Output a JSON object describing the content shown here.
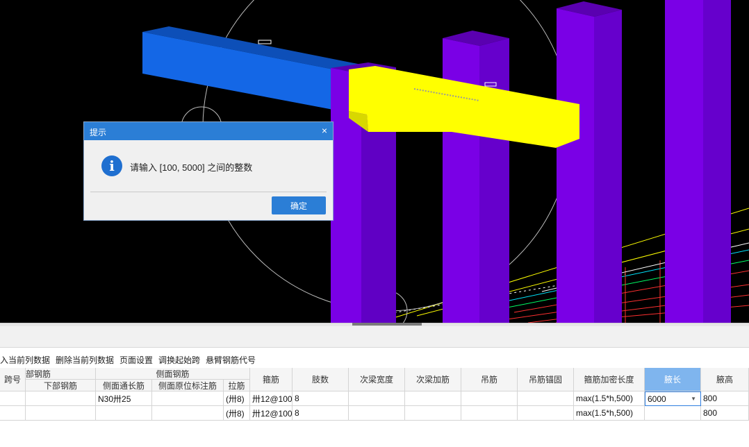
{
  "dialog": {
    "title": "提示",
    "close_glyph": "×",
    "icon": "info-icon",
    "message": "请输入 [100, 5000] 之间的整数",
    "ok_label": "确定"
  },
  "toolbar": {
    "items": [
      "入当前列数据",
      "删除当前列数据",
      "页面设置",
      "调换起始跨",
      "悬臂钢筋代号"
    ]
  },
  "grid": {
    "group_headers": {
      "left_cut": "跨号",
      "bottom_rebar": "部钢筋",
      "side_rebar": "侧面钢筋"
    },
    "sub_headers": {
      "bottom_rebar": "下部钢筋",
      "side_through": "侧面通长筋",
      "side_original": "侧面原位标注筋",
      "tie": "拉筋"
    },
    "columns": {
      "stirrup": "箍筋",
      "legs": "肢数",
      "secondary_width": "次梁宽度",
      "secondary_add": "次梁加筋",
      "hanger": "吊筋",
      "hanger_anchor": "吊筋锚固",
      "densify_length": "箍筋加密长度",
      "haunch_length": "腋长",
      "haunch_height": "腋高"
    },
    "rows": [
      {
        "side_through": "N30卅25",
        "tie": "(卅8)",
        "stirrup": "卅12@100",
        "legs": "8",
        "densify_length": "max(1.5*h,500)",
        "haunch_length": "6000",
        "haunch_height": "800"
      },
      {
        "side_through": "",
        "tie": "(卅8)",
        "stirrup": "卅12@100",
        "legs": "8",
        "densify_length": "max(1.5*h,500)",
        "haunch_length": "",
        "haunch_height": "800"
      }
    ]
  },
  "colors": {
    "viewport_bg": "#000000",
    "beam_blue": "#1467e6",
    "beam_yellow": "#ffff00",
    "column_purple": "#7a00e6",
    "accent": "#2b7ed6",
    "selected_header": "#7fb5ee"
  }
}
